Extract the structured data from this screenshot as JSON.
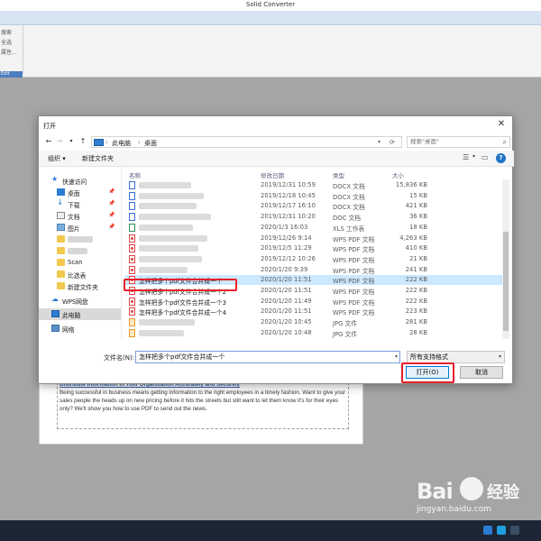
{
  "app": {
    "title": "Solid Converter",
    "menu": [
      "搜索",
      "全选",
      "属性..."
    ],
    "group_label": "Edit"
  },
  "document": {
    "heading": "Distribute Information in Your Organization Accurately and Securely",
    "body": "Being successful in business means getting information to the right employees in a timely fashion. Want to give your sales people the heads up on new pricing before it hits the streets but still want to let them know it's for their eyes only? We'll show you how to use PDF to send out the news."
  },
  "dialog": {
    "title": "打开",
    "close": "✕",
    "path": [
      "此电脑",
      "桌面"
    ],
    "search_placeholder": "搜索\"桌面\"",
    "toolbar": {
      "organize": "组织 ▾",
      "new_folder": "新建文件夹"
    },
    "nav": {
      "quick_access": "快速访问",
      "desktop": "桌面",
      "downloads": "下载",
      "documents": "文档",
      "pictures": "图片",
      "scan": "Scan",
      "bixuanbiao": "比选表",
      "new_folder": "新建文件夹",
      "wps": "WPS网盘",
      "this_pc": "此电脑",
      "network": "网络"
    },
    "columns": {
      "name": "名称",
      "date": "修改日期",
      "type": "类型",
      "size": "大小"
    },
    "files": [
      {
        "name": "",
        "date": "2019/12/31 10:59",
        "type": "DOCX 文档",
        "size": "15,836 KB",
        "icon": "doc"
      },
      {
        "name": "",
        "date": "2019/12/18 10:45",
        "type": "DOCX 文档",
        "size": "15 KB",
        "icon": "doc"
      },
      {
        "name": "",
        "date": "2019/12/17 16:10",
        "type": "DOCX 文档",
        "size": "421 KB",
        "icon": "doc"
      },
      {
        "name": "",
        "date": "2019/12/31 10:20",
        "type": "DOC 文档",
        "size": "36 KB",
        "icon": "doc"
      },
      {
        "name": "",
        "date": "2020/1/3 16:03",
        "type": "XLS 工作表",
        "size": "18 KB",
        "icon": "xls"
      },
      {
        "name": "",
        "date": "2019/12/26 9:14",
        "type": "WPS PDF 文档",
        "size": "4,263 KB",
        "icon": "pdf"
      },
      {
        "name": "",
        "date": "2019/12/5 11:29",
        "type": "WPS PDF 文档",
        "size": "410 KB",
        "icon": "pdf"
      },
      {
        "name": "",
        "date": "2019/12/12 10:26",
        "type": "WPS PDF 文档",
        "size": "21 KB",
        "icon": "pdf"
      },
      {
        "name": "",
        "date": "2020/1/20 9:39",
        "type": "WPS PDF 文档",
        "size": "241 KB",
        "icon": "pdf"
      },
      {
        "name": "怎样把多个pdf文件合并成一个",
        "date": "2020/1/20 11:51",
        "type": "WPS PDF 文档",
        "size": "222 KB",
        "icon": "pdf",
        "selected": true
      },
      {
        "name": "怎样把多个pdf文件合并成一个2",
        "date": "2020/1/20 11:51",
        "type": "WPS PDF 文档",
        "size": "222 KB",
        "icon": "pdf"
      },
      {
        "name": "怎样把多个pdf文件合并成一个3",
        "date": "2020/1/20 11:49",
        "type": "WPS PDF 文档",
        "size": "222 KB",
        "icon": "pdf"
      },
      {
        "name": "怎样把多个pdf文件合并成一个4",
        "date": "2020/1/20 11:51",
        "type": "WPS PDF 文档",
        "size": "223 KB",
        "icon": "pdf"
      },
      {
        "name": "",
        "date": "2020/1/20 10:45",
        "type": "JPG 文件",
        "size": "281 KB",
        "icon": "jpg"
      },
      {
        "name": "",
        "date": "2020/1/20 10:48",
        "type": "JPG 文件",
        "size": "28 KB",
        "icon": "jpg"
      }
    ],
    "filename_label": "文件名(N):",
    "filename_value": "怎样把多个pdf文件合并成一个",
    "filter_value": "所有支持格式",
    "open_button": "打开(O)",
    "cancel_button": "取消"
  },
  "watermark": {
    "logo": "Bai",
    "text": "经验",
    "url": "jingyan.baidu.com"
  },
  "colors": {
    "highlight": "#e8202a",
    "selection": "#cce8ff",
    "taskbar": "#1c2634"
  }
}
